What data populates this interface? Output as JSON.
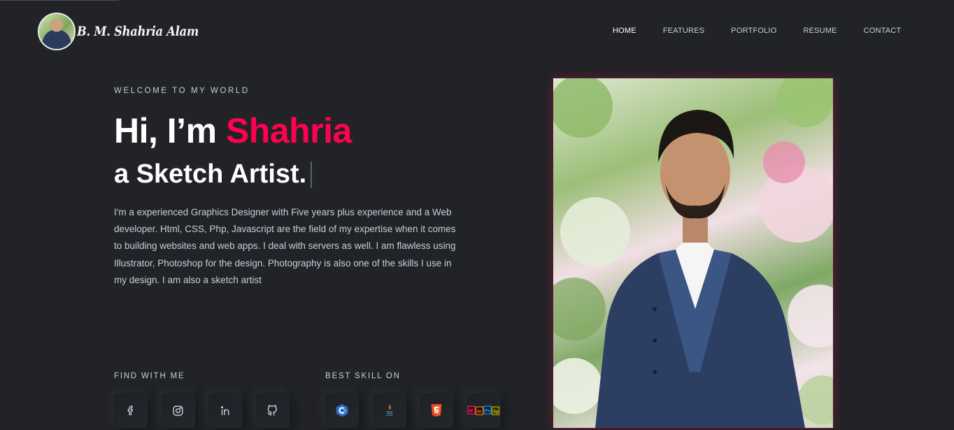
{
  "header": {
    "logo_text": "B. M. Shahria Alam",
    "nav": [
      {
        "label": "HOME",
        "active": true
      },
      {
        "label": "FEATURES",
        "active": false
      },
      {
        "label": "PORTFOLIO",
        "active": false
      },
      {
        "label": "RESUME",
        "active": false
      },
      {
        "label": "CONTACT",
        "active": false
      }
    ]
  },
  "hero": {
    "welcome": "WELCOME TO MY WORLD",
    "greeting": "Hi, I’m ",
    "name": "Shahria",
    "role": "a Sketch Artist.",
    "description": "I'm a experienced Graphics Designer with Five years plus experience and a Web developer. Html, CSS, Php, Javascript are the field of my expertise when it comes to building websites and web apps. I deal with servers as well. I am flawless using Illustrator, Photoshop for the design. Photography is also one of the skills I use in my design. I am also a sketch artist"
  },
  "find_with_me": {
    "label": "FIND WITH ME",
    "icons": [
      "facebook-icon",
      "instagram-icon",
      "linkedin-icon",
      "github-icon"
    ]
  },
  "best_skill_on": {
    "label": "BEST SKILL ON",
    "icons": [
      "cpp-icon",
      "java-icon",
      "html5-icon",
      "adobe-suite-icon"
    ],
    "adobe_labels": [
      "Id",
      "Ai",
      "Ps",
      "Sp"
    ]
  },
  "colors": {
    "accent": "#ff014f",
    "background": "#212327",
    "text": "#c4cfde"
  }
}
